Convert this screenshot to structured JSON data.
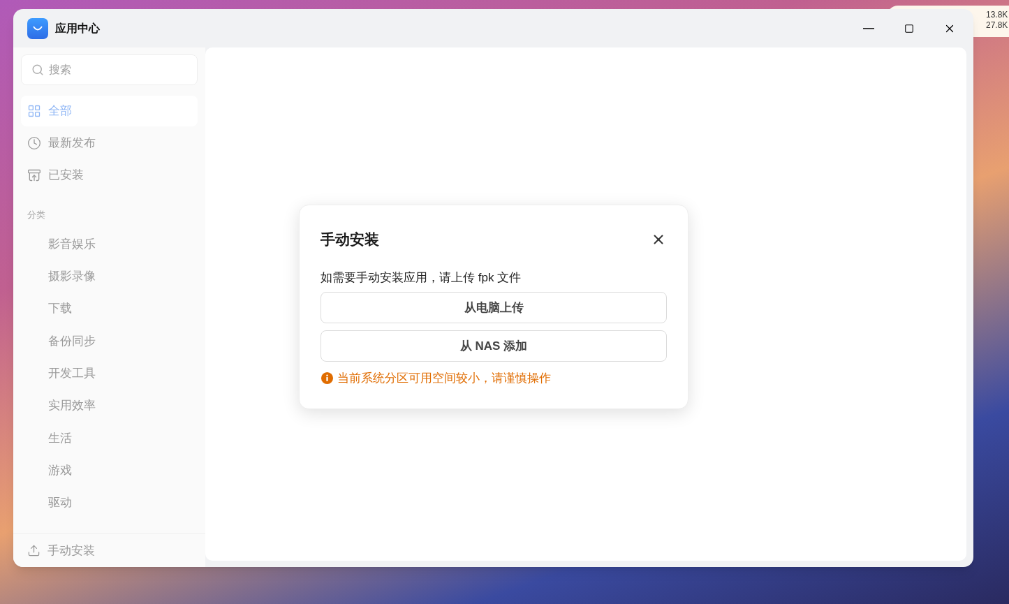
{
  "window": {
    "title": "应用中心"
  },
  "tray": {
    "lines": [
      "13.8K",
      "27.8K"
    ]
  },
  "sidebar": {
    "search": {
      "placeholder": "搜索"
    },
    "nav": [
      {
        "label": "全部",
        "selected": true
      },
      {
        "label": "最新发布",
        "selected": false
      },
      {
        "label": "已安装",
        "selected": false
      }
    ],
    "category_heading": "分类",
    "categories": [
      {
        "label": "影音娱乐",
        "selected": false
      },
      {
        "label": "摄影录像",
        "selected": false
      },
      {
        "label": "下载",
        "selected": false
      },
      {
        "label": "备份同步",
        "selected": false
      },
      {
        "label": "开发工具",
        "selected": false
      },
      {
        "label": "实用效率",
        "selected": false
      },
      {
        "label": "生活",
        "selected": false
      },
      {
        "label": "游戏",
        "selected": false
      },
      {
        "label": "驱动",
        "selected": false
      }
    ],
    "footer": {
      "label": "手动安装"
    }
  },
  "dialog": {
    "title": "手动安装",
    "message": "如需要手动安装应用，请上传 fpk 文件",
    "buttons": [
      "从电脑上传",
      "从 NAS 添加"
    ],
    "warning": "当前系统分区可用空间较小，请谨慎操作"
  }
}
